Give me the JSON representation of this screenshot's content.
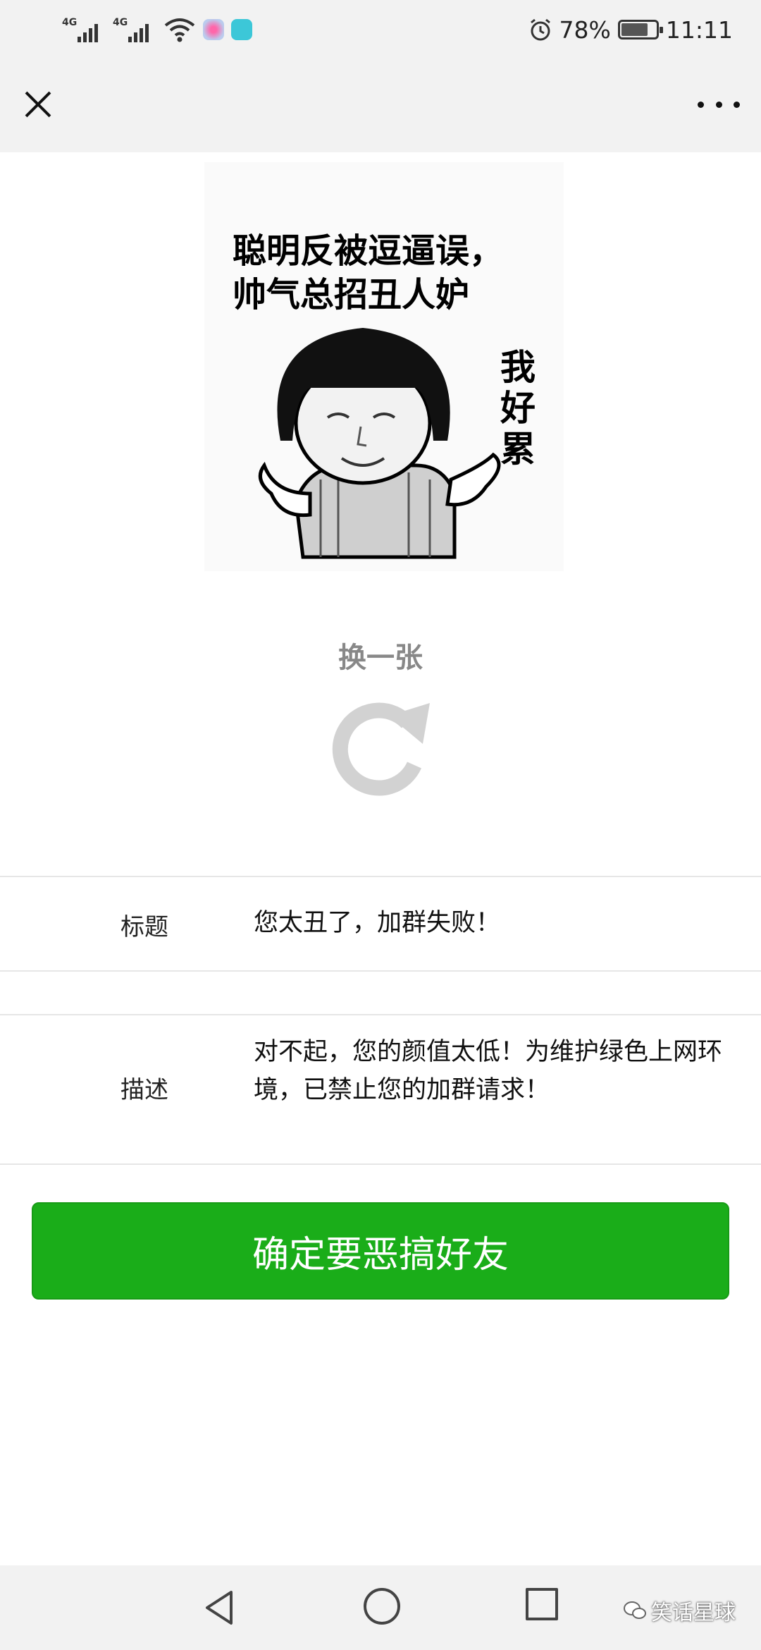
{
  "status_bar": {
    "network_1": "4G",
    "network_2": "4G",
    "battery": "78%",
    "battery_level": 0.78,
    "time": "11:11"
  },
  "meme": {
    "caption": "聪明反被逗逼误，\n帅气总招丑人妒",
    "side_text": "我\n好\n累"
  },
  "refresh": {
    "label": "换一张"
  },
  "form": {
    "title_label": "标题",
    "title_value": "您太丑了，加群失败！",
    "desc_label": "描述",
    "desc_value": "对不起，您的颜值太低！为维护绿色上网环境，已禁止您的加群请求！"
  },
  "confirm_button": "确定要恶搞好友",
  "watermark": "笑话星球",
  "colors": {
    "accent_green": "#1aad19",
    "bar_gray": "#f2f2f2"
  }
}
